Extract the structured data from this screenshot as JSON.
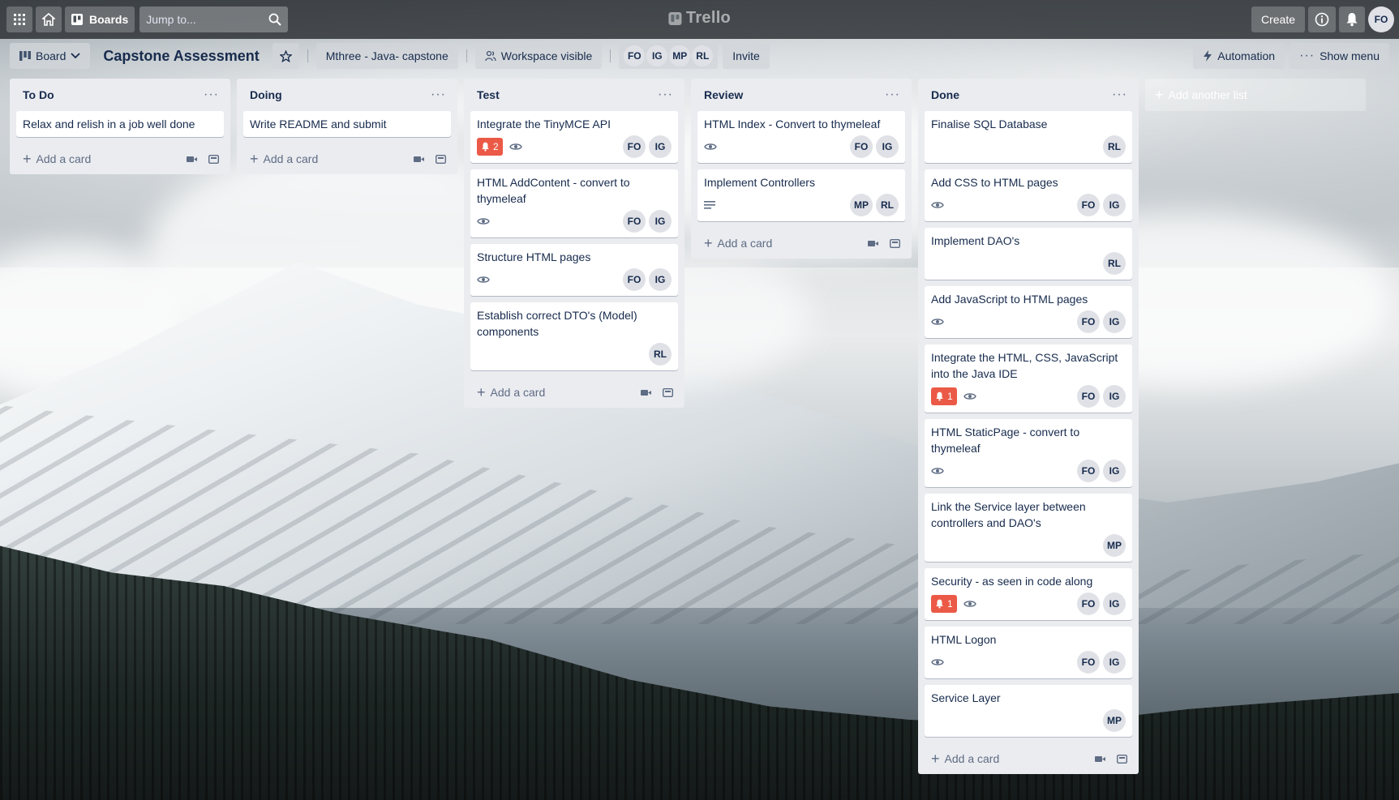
{
  "header": {
    "boards_label": "Boards",
    "search_placeholder": "Jump to...",
    "logo_text": "Trello",
    "create_label": "Create",
    "user_initials": "FO"
  },
  "board": {
    "view_label": "Board",
    "title": "Capstone Assessment",
    "workspace": "Mthree - Java- capstone",
    "visibility": "Workspace visible",
    "members": [
      "FO",
      "IG",
      "MP",
      "RL"
    ],
    "invite_label": "Invite",
    "automation_label": "Automation",
    "show_menu_label": "Show menu"
  },
  "lists": [
    {
      "title": "To Do",
      "add_label": "Add a card",
      "cards": [
        {
          "title": "Relax and relish in a job well done",
          "members": [],
          "due": null,
          "watch": false,
          "desc": false
        }
      ]
    },
    {
      "title": "Doing",
      "add_label": "Add a card",
      "cards": [
        {
          "title": "Write README and submit",
          "members": [],
          "due": null,
          "watch": false,
          "desc": false
        }
      ]
    },
    {
      "title": "Test",
      "add_label": "Add a card",
      "cards": [
        {
          "title": "Integrate the TinyMCE API",
          "members": [
            "FO",
            "IG"
          ],
          "due": "2",
          "watch": true,
          "desc": false
        },
        {
          "title": "HTML AddContent - convert to thymeleaf",
          "members": [
            "FO",
            "IG"
          ],
          "due": null,
          "watch": true,
          "desc": false
        },
        {
          "title": "Structure HTML pages",
          "members": [
            "FO",
            "IG"
          ],
          "due": null,
          "watch": true,
          "desc": false
        },
        {
          "title": "Establish correct DTO's (Model) components",
          "members": [
            "RL"
          ],
          "due": null,
          "watch": false,
          "desc": false
        }
      ]
    },
    {
      "title": "Review",
      "add_label": "Add a card",
      "cards": [
        {
          "title": "HTML Index - Convert to thymeleaf",
          "members": [
            "FO",
            "IG"
          ],
          "due": null,
          "watch": true,
          "desc": false
        },
        {
          "title": "Implement Controllers",
          "members": [
            "MP",
            "RL"
          ],
          "due": null,
          "watch": false,
          "desc": true
        }
      ]
    },
    {
      "title": "Done",
      "add_label": "Add a card",
      "cards": [
        {
          "title": "Finalise SQL Database",
          "members": [
            "RL"
          ],
          "due": null,
          "watch": false,
          "desc": false
        },
        {
          "title": "Add CSS to HTML pages",
          "members": [
            "FO",
            "IG"
          ],
          "due": null,
          "watch": true,
          "desc": false
        },
        {
          "title": "Implement DAO's",
          "members": [
            "RL"
          ],
          "due": null,
          "watch": false,
          "desc": false
        },
        {
          "title": "Add JavaScript to HTML pages",
          "members": [
            "FO",
            "IG"
          ],
          "due": null,
          "watch": true,
          "desc": false
        },
        {
          "title": "Integrate the HTML, CSS, JavaScript into the Java IDE",
          "members": [
            "FO",
            "IG"
          ],
          "due": "1",
          "watch": true,
          "desc": false
        },
        {
          "title": "HTML StaticPage - convert to thymeleaf",
          "members": [
            "FO",
            "IG"
          ],
          "due": null,
          "watch": true,
          "desc": false
        },
        {
          "title": "Link the Service layer between controllers and DAO's",
          "members": [
            "MP"
          ],
          "due": null,
          "watch": false,
          "desc": false
        },
        {
          "title": "Security - as seen in code along",
          "members": [
            "FO",
            "IG"
          ],
          "due": "1",
          "watch": true,
          "desc": false
        },
        {
          "title": "HTML Logon",
          "members": [
            "FO",
            "IG"
          ],
          "due": null,
          "watch": true,
          "desc": false
        },
        {
          "title": "Service Layer",
          "members": [
            "MP"
          ],
          "due": null,
          "watch": false,
          "desc": false
        }
      ]
    }
  ],
  "add_list_label": "Add another list",
  "colors": {
    "due_badge": "#eb5a46",
    "list_bg": "#ebecf0"
  }
}
